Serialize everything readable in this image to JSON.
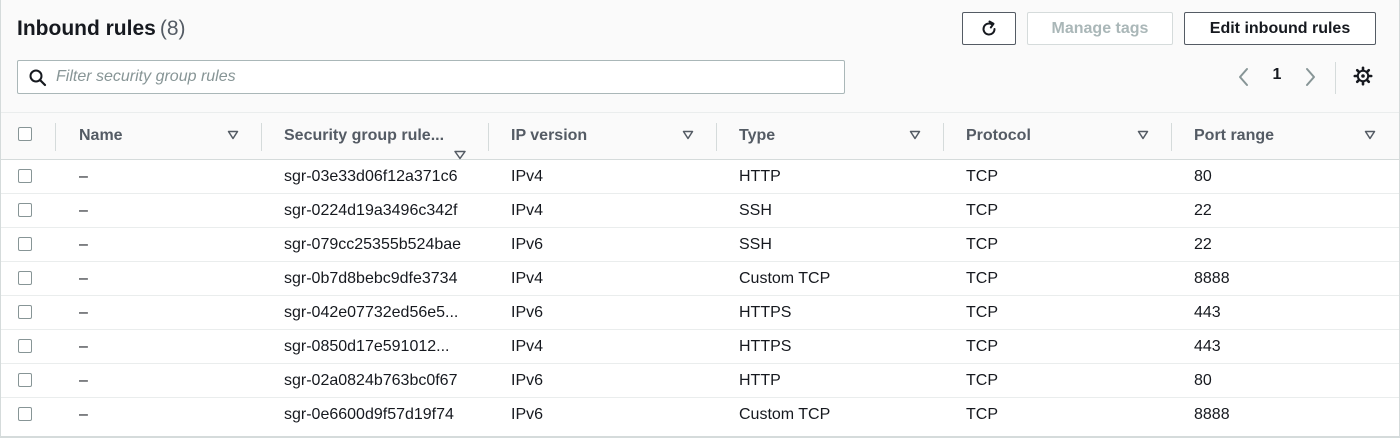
{
  "header": {
    "title": "Inbound rules",
    "count": "(8)",
    "manage_tags_label": "Manage tags",
    "edit_label": "Edit inbound rules"
  },
  "search": {
    "placeholder": "Filter security group rules",
    "value": ""
  },
  "pagination": {
    "current_page": "1"
  },
  "icons": {
    "refresh": "refresh-icon",
    "search": "search-icon",
    "prev": "chevron-left-icon",
    "next": "chevron-right-icon",
    "settings": "gear-icon",
    "sort": "caret-down-icon"
  },
  "colors": {
    "text": "#16191f",
    "muted": "#545b64",
    "disabled": "#aab7b8",
    "border": "#d5dbdb"
  },
  "table": {
    "columns": [
      "Name",
      "Security group rule...",
      "IP version",
      "Type",
      "Protocol",
      "Port range"
    ],
    "rows": [
      [
        "–",
        "sgr-03e33d06f12a371c6",
        "IPv4",
        "HTTP",
        "TCP",
        "80"
      ],
      [
        "–",
        "sgr-0224d19a3496c342f",
        "IPv4",
        "SSH",
        "TCP",
        "22"
      ],
      [
        "–",
        "sgr-079cc25355b524bae",
        "IPv6",
        "SSH",
        "TCP",
        "22"
      ],
      [
        "–",
        "sgr-0b7d8bebc9dfe3734",
        "IPv4",
        "Custom TCP",
        "TCP",
        "8888"
      ],
      [
        "–",
        "sgr-042e07732ed56e5...",
        "IPv6",
        "HTTPS",
        "TCP",
        "443"
      ],
      [
        "–",
        "sgr-0850d17e591012...",
        "IPv4",
        "HTTPS",
        "TCP",
        "443"
      ],
      [
        "–",
        "sgr-02a0824b763bc0f67",
        "IPv6",
        "HTTP",
        "TCP",
        "80"
      ],
      [
        "–",
        "sgr-0e6600d9f57d19f74",
        "IPv6",
        "Custom TCP",
        "TCP",
        "8888"
      ]
    ]
  }
}
